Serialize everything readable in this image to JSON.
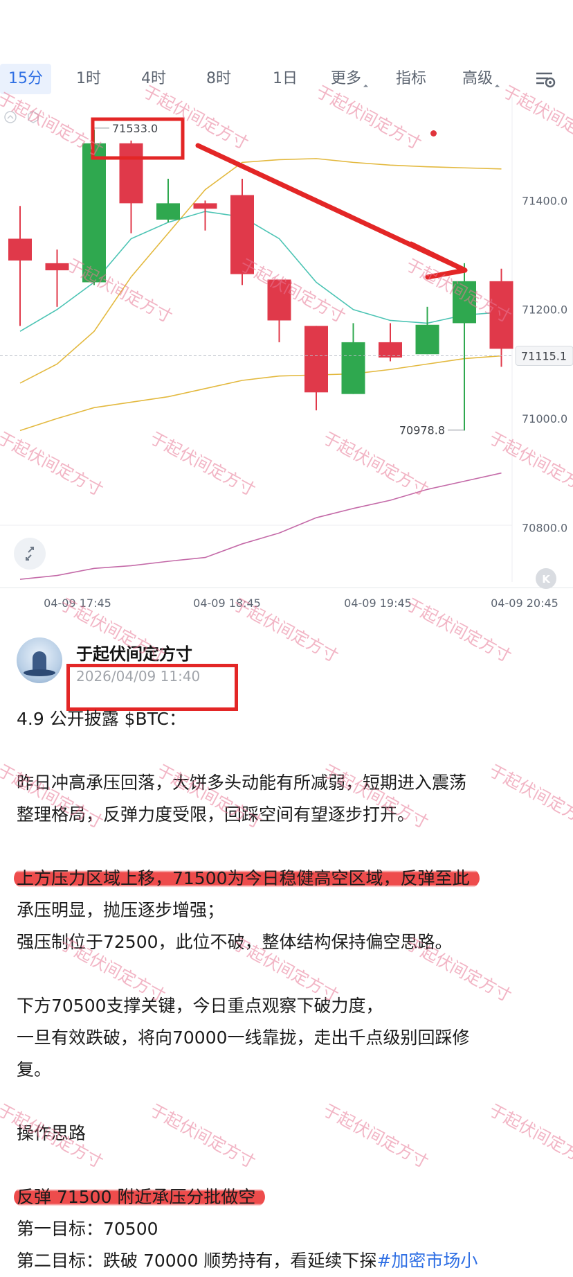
{
  "toolbar": {
    "tabs": [
      "15分",
      "1时",
      "4时",
      "8时",
      "1日",
      "更多",
      "指标",
      "高级"
    ]
  },
  "chart_data": {
    "type": "candlestick",
    "price_axis": [
      "71400.0",
      "71200.0",
      "71000.0",
      "70800.0"
    ],
    "price_range": [
      70700,
      71590
    ],
    "time_axis": [
      "04-09 17:45",
      "04-09 18:45",
      "04-09 19:45",
      "04-09 20:45"
    ],
    "last_price": "71115.1",
    "high_label": "71533.0",
    "low_label": "70978.8",
    "colors": {
      "up": "#2fa84f",
      "down": "#e0394a",
      "ma1": "#e3b93f",
      "ma2": "#4cc4b4",
      "ma3": "#c46aa8",
      "arrow": "#e32626"
    },
    "candles": [
      {
        "o": 71330,
        "h": 71390,
        "l": 71170,
        "c": 71290
      },
      {
        "o": 71285,
        "h": 71310,
        "l": 71205,
        "c": 71272
      },
      {
        "o": 71250,
        "h": 71530,
        "l": 71245,
        "c": 71505
      },
      {
        "o": 71505,
        "h": 71510,
        "l": 71340,
        "c": 71395
      },
      {
        "o": 71365,
        "h": 71440,
        "l": 71360,
        "c": 71395
      },
      {
        "o": 71395,
        "h": 71400,
        "l": 71345,
        "c": 71385
      },
      {
        "o": 71410,
        "h": 71440,
        "l": 71245,
        "c": 71265
      },
      {
        "o": 71255,
        "h": 71255,
        "l": 71140,
        "c": 71180
      },
      {
        "o": 71170,
        "h": 71170,
        "l": 71015,
        "c": 71048
      },
      {
        "o": 71045,
        "h": 71175,
        "l": 71045,
        "c": 71140
      },
      {
        "o": 71140,
        "h": 71175,
        "l": 71105,
        "c": 71112
      },
      {
        "o": 71118,
        "h": 71205,
        "l": 71118,
        "c": 71172
      },
      {
        "o": 71175,
        "h": 71285,
        "l": 70978,
        "c": 71252
      },
      {
        "o": 71252,
        "h": 71275,
        "l": 71095,
        "c": 71128
      }
    ],
    "ma_yellow": [
      71065,
      71100,
      71160,
      71260,
      71340,
      71420,
      71470,
      71475,
      71477,
      71470,
      71465,
      71462,
      71460,
      71458
    ],
    "ma_teal": [
      71160,
      71200,
      71250,
      71330,
      71360,
      71380,
      71370,
      71330,
      71250,
      71200,
      71180,
      71175,
      71190,
      71195
    ],
    "ma_lower_yellow": [
      70978,
      71000,
      71020,
      71030,
      71040,
      71055,
      71070,
      71078,
      71080,
      71082,
      71090,
      71100,
      71110,
      71115
    ],
    "ma_purple": [
      70705,
      70712,
      70725,
      70730,
      70738,
      70745,
      70770,
      70790,
      70818,
      70835,
      70850,
      70870,
      70885,
      70900
    ]
  },
  "post": {
    "author": "于起伏间定方寸",
    "time": "2026/04/09 11:40",
    "lines": [
      "4.9 公开披露 $BTC：",
      "",
      "昨日冲高承压回落，大饼多头动能有所减弱，短期进入震荡",
      "整理格局，反弹力度受限，回踩空间有望逐步打开。",
      "",
      "上方压力区域上移，71500为今日稳健高空区域，反弹至此",
      "承压明显，抛压逐步增强；",
      "强压制位于72500，此位不破，整体结构保持偏空思路。",
      "",
      "下方70500支撑关键，今日重点观察下破力度，",
      "一旦有效跌破，将向70000一线靠拢，走出千点级别回踩修",
      "复。",
      "",
      "操作思路",
      "",
      "反弹 71500 附近承压分批做空",
      "第一目标：70500",
      "第二目标：跌破 70000 顺势持有，看延续下探"
    ],
    "hashtag": "#加密市场小"
  },
  "watermark": "于起伏间定方寸"
}
